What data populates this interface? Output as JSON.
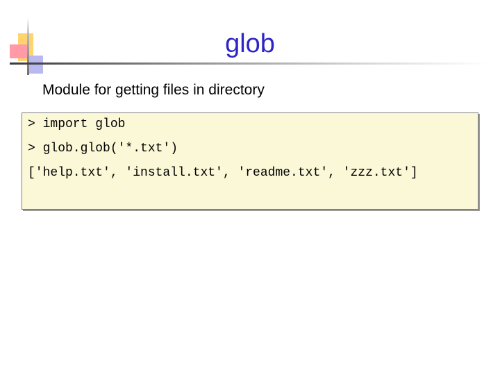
{
  "slide": {
    "title": "glob",
    "subtitle": "Module for getting files in directory",
    "code_lines": [
      "> import glob",
      "> glob.glob('*.txt')",
      "['help.txt', 'install.txt', 'readme.txt', 'zzz.txt']"
    ]
  },
  "colors": {
    "title": "#2d24c8",
    "code_background": "#fbf8d8",
    "accent_yellow": "#ffd36e",
    "accent_red": "#ff9aa6",
    "accent_blue": "#b9b8f0"
  }
}
